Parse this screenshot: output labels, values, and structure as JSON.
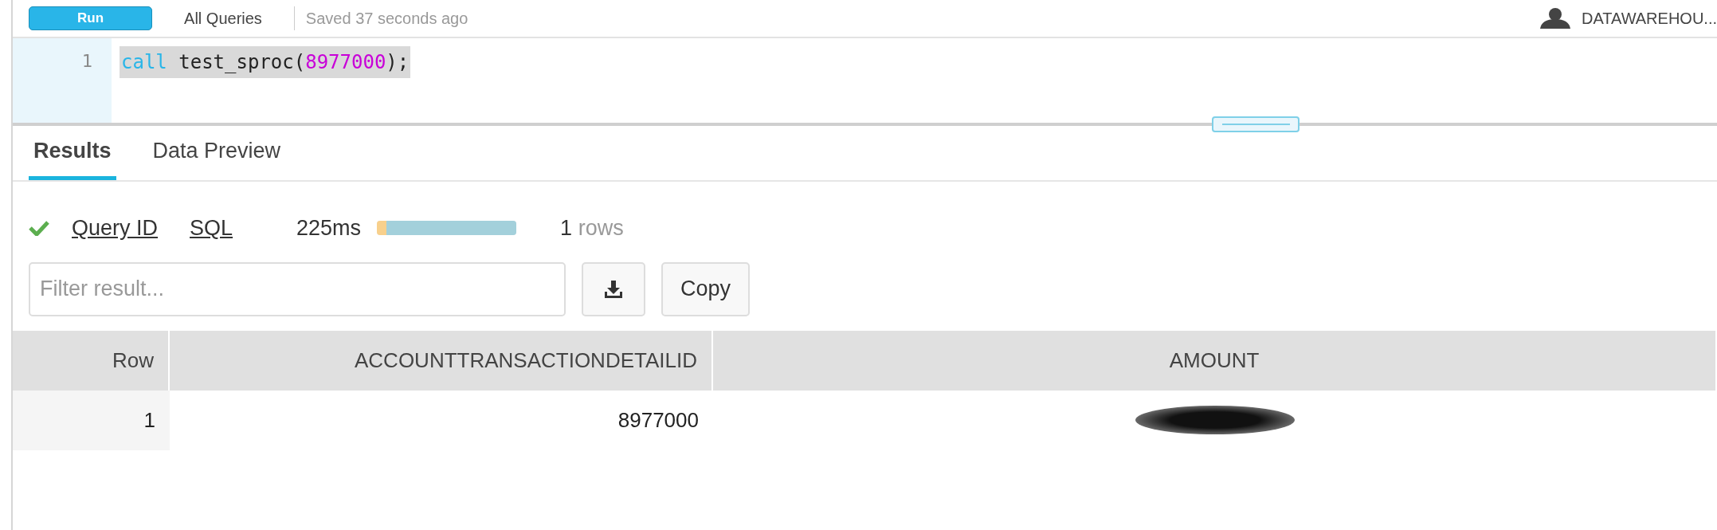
{
  "toolbar": {
    "run_button": "Run",
    "worksheet": "All Queries",
    "saved": "Saved 37 seconds ago",
    "user": "DATAWAREHOU..."
  },
  "editor": {
    "lines": [
      {
        "number": "1",
        "selected": true,
        "tokens": [
          {
            "kind": "keyword",
            "text": "call"
          },
          {
            "kind": "plain",
            "text": " test_sproc("
          },
          {
            "kind": "number",
            "text": "8977000"
          },
          {
            "kind": "plain",
            "text": ");"
          }
        ]
      }
    ]
  },
  "tabs": [
    {
      "label": "Results",
      "selected": true
    },
    {
      "label": "Data Preview",
      "selected": false
    }
  ],
  "status": {
    "success": true,
    "query_id_link": "Query ID",
    "sql_link": "SQL",
    "duration": "225ms",
    "timing": [
      {
        "color": "#f8d08c",
        "level": 0.07
      },
      {
        "color": "#a3d0db",
        "level": 0.93
      }
    ],
    "row_count": "1",
    "rows_label": "rows"
  },
  "filter": {
    "placeholder": "Filter result..."
  },
  "copy_button": "Copy",
  "table": {
    "columns": [
      "Row",
      "ACCOUNTTRANSACTIONDETAILID",
      "AMOUNT"
    ],
    "rows": [
      {
        "cells": [
          "1",
          "8977000"
        ],
        "redacted": true
      }
    ]
  }
}
